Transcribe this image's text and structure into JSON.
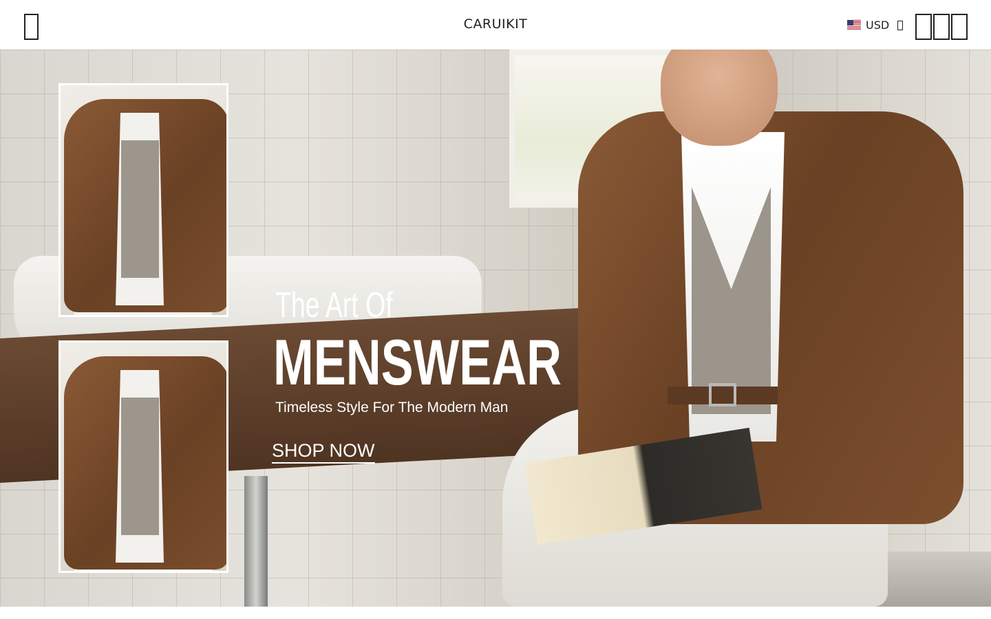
{
  "header": {
    "brand": "CARUIKIT",
    "currency": {
      "code": "USD",
      "flag": "us-flag-icon"
    },
    "icons": [
      "menu-icon",
      "search-icon",
      "account-icon",
      "cart-icon"
    ]
  },
  "hero": {
    "headline_small": "The Art Of",
    "headline_big": "MENSWEAR",
    "tagline": "Timeless Style For The Modern Man",
    "cta_label": "SHOP NOW",
    "text_color": "#ffffff",
    "jacket_color": "#6a4124"
  }
}
